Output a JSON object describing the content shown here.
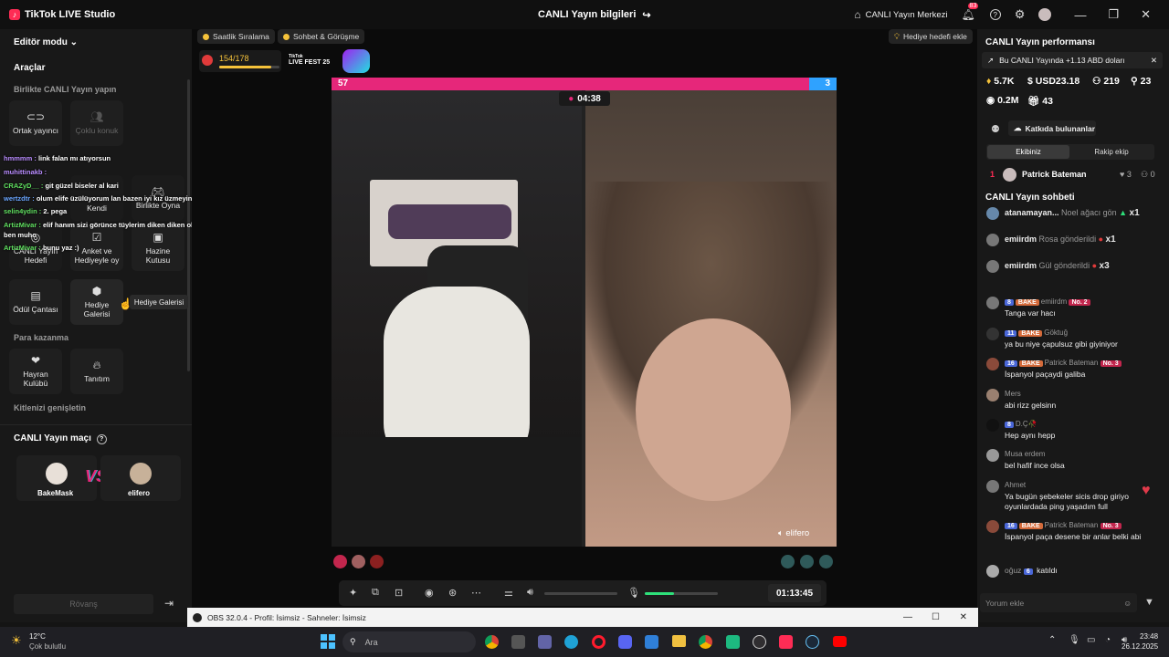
{
  "titlebar": {
    "app_name": "TikTok LIVE Studio",
    "center_title": "CANLI Yayın bilgileri",
    "live_center": "CANLI Yayın Merkezi",
    "notif_count": "83"
  },
  "left": {
    "editor_mode": "Editör modu",
    "tools_title": "Araçlar",
    "section_together": "Birlikte CANLI Yayın yapın",
    "tools": [
      "Ortak yayıncı",
      "Çoklu konuk",
      "Kendi",
      "Birlikte Oyna",
      "CANLI Yayın Hedefi",
      "Anket ve Hediyeyle oy",
      "Hazine Kutusu",
      "Ödül Çantası",
      "Hediye Galerisi"
    ],
    "section_money": "Para kazanma",
    "money_tools": [
      "Hayran Kulübü",
      "Tanıtım"
    ],
    "section_audience": "Kitlenizi genişletin",
    "tooltip": "Hediye Galerisi",
    "chat_overlay": [
      {
        "user": "hmmmm :",
        "msg": "link falan mı atıyorsun"
      },
      {
        "user": "muhittinakb :",
        "msg": ""
      },
      {
        "user": "CRAZyD__ :",
        "msg": "git güzel biseler al kari"
      },
      {
        "user": "wertzdtr :",
        "msg": "olum elife üzülüyorum lan bazen iyi kız üzmeyin"
      },
      {
        "user": "selin4ydin :",
        "msg": "2. pega"
      },
      {
        "user": "ArtizMivar :",
        "msg": "elif hanım sizi görünce tüylerim diken diken oluyor meme uçlarım sertleşiyor bu arda ben muho"
      },
      {
        "user": "ArtizMivar :",
        "msg": "bunu yaz :)"
      }
    ],
    "match_title": "CANLI Yayın maçı",
    "player1": "BakeMask",
    "player2": "elifero",
    "rematch": "Rövanş"
  },
  "stage": {
    "pill1": "Saatlik Sıralama",
    "pill2": "Sohbet & Görüşme",
    "gift_goal": "Hediye hedefi ekle",
    "progress_text": "154/178",
    "progress_fraction": 0.865,
    "fest_label": "LIVE FEST 25",
    "score_left": "57",
    "score_right": "3",
    "battle_timer": "04:38",
    "right_name": "elifero",
    "elapsed": "01:13:45",
    "mic_level": 0.4
  },
  "right": {
    "perf_title": "CANLI Yayın performansı",
    "perf_banner": "Bu CANLI Yayında +1.13 ABD doları",
    "stats": {
      "likes": "5.7K",
      "usd": "USD23.18",
      "viewers": "219",
      "new_followers": "23",
      "views": "0.2M",
      "gifters": "43"
    },
    "contributors_btn": "Katkıda bulunanlar",
    "tab_team": "Ekibiniz",
    "tab_rival": "Rakip ekip",
    "top_rank": "1",
    "top_name": "Patrick Bateman",
    "top_count": "3",
    "top_zero": "0",
    "chat_title": "CANLI Yayın sohbeti",
    "gifts": [
      {
        "user": "atanamayan...",
        "gift": "Noel ağacı gön",
        "mult": "x1"
      },
      {
        "user": "emiirdm",
        "gift": "Rosa gönderildi",
        "mult": "x1"
      },
      {
        "user": "emiirdm",
        "gift": "Gül gönderildi",
        "mult": "x3"
      }
    ],
    "comments": [
      {
        "lvl": "8",
        "tag": "BAKE",
        "user": "emiirdm",
        "rank": "No. 2",
        "msg": "Tanga var hacı"
      },
      {
        "lvl": "11",
        "tag": "BAKE",
        "user": "Göktuğ",
        "rank": "",
        "msg": "ya bu niye çapulsuz gibi giyiniyor"
      },
      {
        "lvl": "16",
        "tag": "BAKE",
        "user": "Patrick Bateman",
        "rank": "No. 3",
        "msg": "İspanyol paçaydi galiba"
      },
      {
        "lvl": "",
        "tag": "",
        "user": "Mers",
        "rank": "",
        "msg": "abi rizz gelsinn"
      },
      {
        "lvl": "8",
        "tag": "",
        "user": "D.Ç🥀",
        "rank": "",
        "msg": "Hep aynı hepp"
      },
      {
        "lvl": "",
        "tag": "",
        "user": "Musa erdem",
        "rank": "",
        "msg": "bel hafif ince olsa"
      },
      {
        "lvl": "",
        "tag": "",
        "user": "Ahmet",
        "rank": "",
        "msg": "Ya bugün şebekeler sicis drop giriyo oyunlardada ping yaşadım full"
      },
      {
        "lvl": "16",
        "tag": "BAKE",
        "user": "Patrick Bateman",
        "rank": "No. 3",
        "msg": "İspanyol paça desene bir anlar belki abi"
      }
    ],
    "join_user": "oğuz",
    "join_lvl": "6",
    "join_text": "katıldı",
    "comment_placeholder": "Yorum ekle"
  },
  "obs": {
    "title": "OBS 32.0.4 - Profil: İsimsiz - Sahneler: İsimsiz"
  },
  "taskbar": {
    "temp": "12°C",
    "weather": "Çok bulutlu",
    "search": "Ara",
    "time": "23:48",
    "date": "26.12.2025"
  }
}
